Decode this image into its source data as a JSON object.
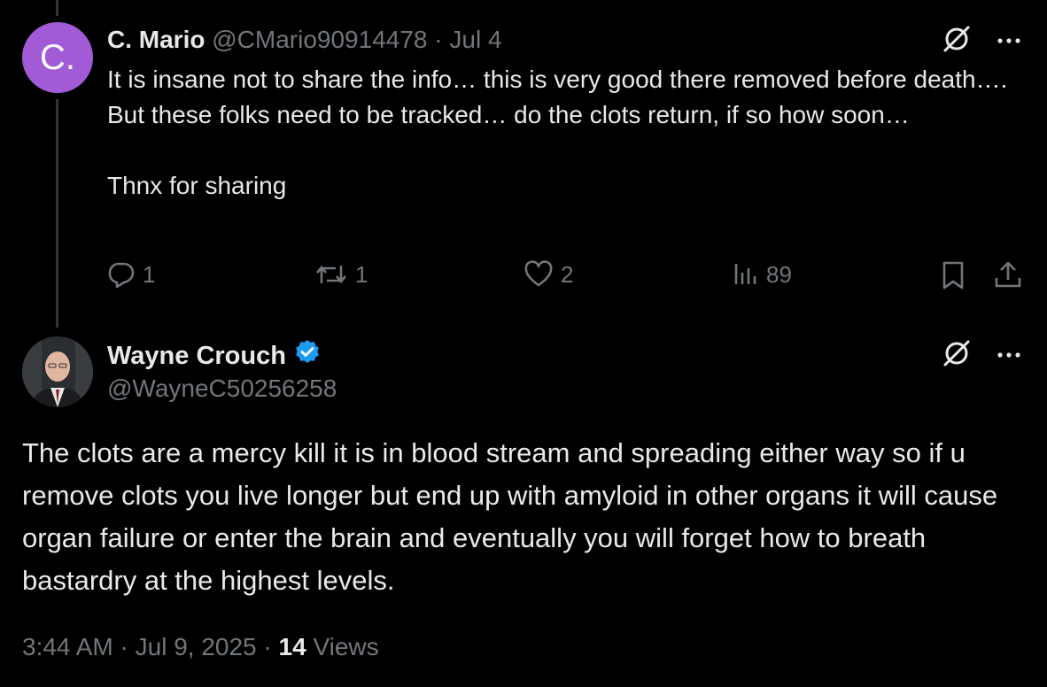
{
  "reply": {
    "avatar_letter": "C.",
    "name": "C. Mario",
    "handle": "@CMario90914478",
    "separator": "·",
    "date": "Jul 4",
    "text_lines": [
      "It is insane not to share the info… this is very good there removed before death…. But these folks need to be tracked… do the clots return, if so how soon…",
      "Thnx for sharing"
    ],
    "actions": {
      "replies": "1",
      "reposts": "1",
      "likes": "2",
      "views": "89"
    },
    "more_label": "···"
  },
  "main": {
    "name": "Wayne Crouch",
    "handle": "@WayneC50256258",
    "text": "The clots are a mercy kill it is in blood stream and spreading either way so if u remove clots you live longer but end up with amyloid in other organs it will cause organ failure or enter the brain and eventually you will forget how to breath bastardry at the highest levels.",
    "time": "3:44 AM",
    "separator": "·",
    "date": "Jul 9, 2025",
    "views_count": "14",
    "views_label": "Views",
    "more_label": "···"
  },
  "colors": {
    "background": "#000000",
    "text": "#e7e9ea",
    "muted": "#71767b",
    "verified": "#1d9bf0",
    "avatar_purple": "#a25bd6"
  },
  "icons": [
    "grok-icon",
    "more-icon",
    "reply-icon",
    "repost-icon",
    "like-icon",
    "views-icon",
    "bookmark-icon",
    "share-icon",
    "verified-badge-icon"
  ]
}
